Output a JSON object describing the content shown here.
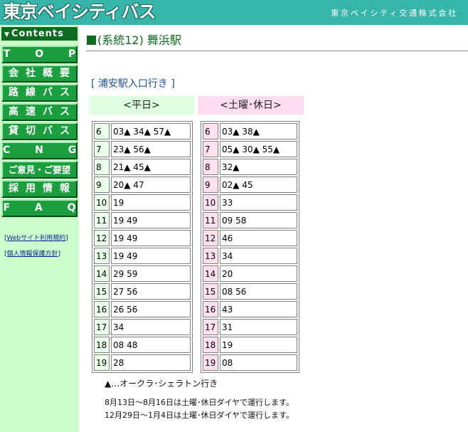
{
  "header": {
    "logo": "東京ベイシティバス",
    "company": "東京ベイシティ交通株式会社",
    "background_color": "#37b5a9"
  },
  "sidebar": {
    "contents_label": "Contents",
    "nav": [
      {
        "label": "T O P"
      },
      {
        "label": "会社概要"
      },
      {
        "label": "路線バス"
      },
      {
        "label": "高速バス"
      },
      {
        "label": "貸切バス"
      },
      {
        "label": "C N G"
      },
      {
        "label": "ご意見・ご要望"
      },
      {
        "label": "採用情報"
      },
      {
        "label": "F A Q"
      }
    ],
    "links": [
      {
        "open": "[",
        "label": "Webサイト利用規約",
        "close": "]"
      },
      {
        "open": "[",
        "label": "個人情報保護方針",
        "close": "]"
      }
    ],
    "background_color": "#ccffcc"
  },
  "main": {
    "title": "(系統12) 舞浜駅",
    "destination": "[ 浦安駅入口行き ]",
    "weekday_label": "<平日>",
    "weekend_label": "<土曜･休日>",
    "weekday": [
      {
        "hour": "6",
        "minutes": "03▲ 34▲ 57▲"
      },
      {
        "hour": "7",
        "minutes": "23▲ 56▲"
      },
      {
        "hour": "8",
        "minutes": "21▲ 45▲"
      },
      {
        "hour": "9",
        "minutes": "20▲ 47"
      },
      {
        "hour": "10",
        "minutes": "19"
      },
      {
        "hour": "11",
        "minutes": "19 49"
      },
      {
        "hour": "12",
        "minutes": "19 49"
      },
      {
        "hour": "13",
        "minutes": "19 49"
      },
      {
        "hour": "14",
        "minutes": "29 59"
      },
      {
        "hour": "15",
        "minutes": "27 56"
      },
      {
        "hour": "16",
        "minutes": "26 56"
      },
      {
        "hour": "17",
        "minutes": "34"
      },
      {
        "hour": "18",
        "minutes": "08 48"
      },
      {
        "hour": "19",
        "minutes": "28"
      }
    ],
    "weekend": [
      {
        "hour": "6",
        "minutes": "03▲ 38▲"
      },
      {
        "hour": "7",
        "minutes": "05▲ 30▲ 55▲"
      },
      {
        "hour": "8",
        "minutes": "32▲"
      },
      {
        "hour": "9",
        "minutes": "02▲ 45"
      },
      {
        "hour": "10",
        "minutes": "33"
      },
      {
        "hour": "11",
        "minutes": "09 58"
      },
      {
        "hour": "12",
        "minutes": "46"
      },
      {
        "hour": "13",
        "minutes": "34"
      },
      {
        "hour": "14",
        "minutes": "20"
      },
      {
        "hour": "15",
        "minutes": "08 56"
      },
      {
        "hour": "16",
        "minutes": "43"
      },
      {
        "hour": "17",
        "minutes": "31"
      },
      {
        "hour": "18",
        "minutes": "19"
      },
      {
        "hour": "19",
        "minutes": "08"
      }
    ],
    "legend": "▲…オークラ･シェラトン行き",
    "notes": [
      "8月13日～8月16日は土曜･休日ダイヤで運行します。",
      "12月29日～1月4日は土曜･休日ダイヤで運行します。"
    ]
  }
}
